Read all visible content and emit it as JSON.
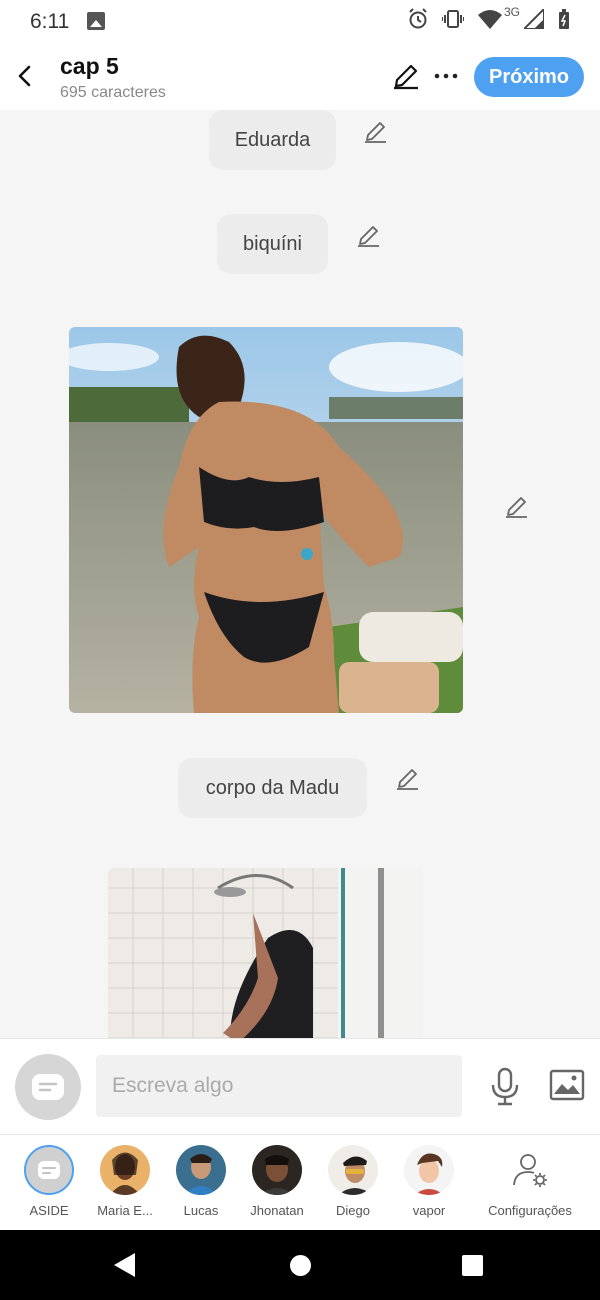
{
  "status_bar": {
    "time": "6:11",
    "network": "3G"
  },
  "header": {
    "title": "cap 5",
    "subtitle": "695 caracteres",
    "next_label": "Próximo",
    "accent_color": "#4ea0f0"
  },
  "messages": [
    {
      "type": "text",
      "text": "Eduarda"
    },
    {
      "type": "text",
      "text": "biquíni"
    },
    {
      "type": "image",
      "description_icon": "beach-photo"
    },
    {
      "type": "text",
      "text": "corpo da Madu"
    },
    {
      "type": "image",
      "description_icon": "shower-photo"
    }
  ],
  "compose": {
    "placeholder": "Escreva algo"
  },
  "characters": [
    {
      "name": "ASIDE"
    },
    {
      "name": "Maria E..."
    },
    {
      "name": "Lucas"
    },
    {
      "name": "Jhonatan"
    },
    {
      "name": "Diego"
    },
    {
      "name": "vapor"
    },
    {
      "name": "Configurações"
    }
  ],
  "icons": {
    "back": "chevron-left-icon",
    "edit": "pencil-icon",
    "more": "more-horizontal-icon",
    "mic": "microphone-icon",
    "image": "image-icon",
    "settings": "user-gear-icon"
  }
}
